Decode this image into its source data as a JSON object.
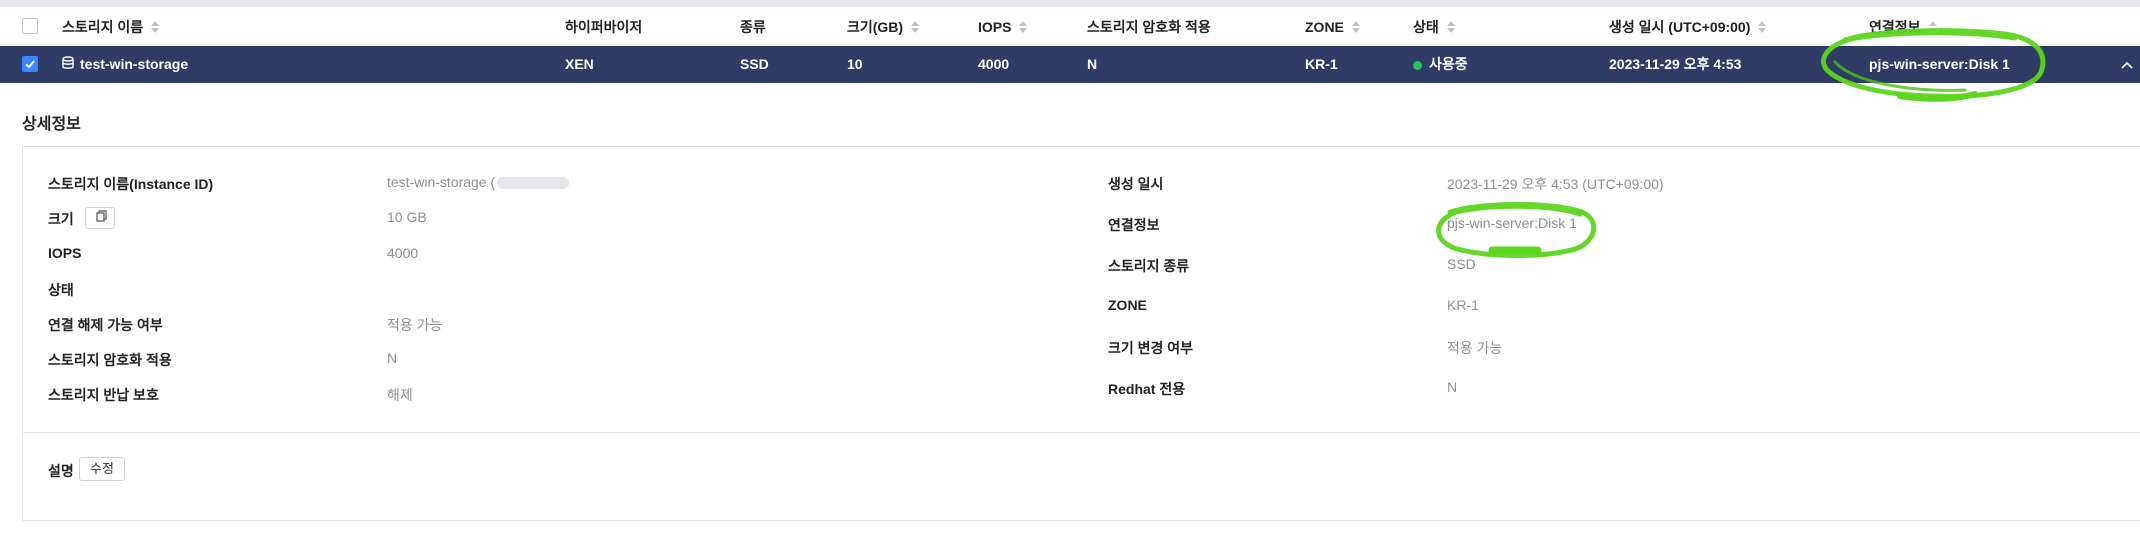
{
  "table": {
    "headers": {
      "name": "스토리지 이름",
      "hypervisor": "하이퍼바이저",
      "type": "종류",
      "size": "크기(GB)",
      "iops": "IOPS",
      "encryption": "스토리지 암호화 적용",
      "zone": "ZONE",
      "status": "상태",
      "created": "생성 일시 (UTC+09:00)",
      "connection": "연결정보"
    },
    "row": {
      "name": "test-win-storage",
      "hypervisor": "XEN",
      "type": "SSD",
      "size": "10",
      "iops": "4000",
      "encryption": "N",
      "zone": "KR-1",
      "status": "사용중",
      "created": "2023-11-29 오후 4:53",
      "connection": "pjs-win-server:Disk 1"
    }
  },
  "details": {
    "title": "상세정보",
    "left": {
      "name_label": "스토리지 이름(Instance ID)",
      "name_value": "test-win-storage (",
      "size_label": "크기",
      "size_value": "10 GB",
      "iops_label": "IOPS",
      "iops_value": "4000",
      "status_label": "상태",
      "detach_label": "연결 해제 가능 여부",
      "detach_value": "적용 가능",
      "encryption_label": "스토리지 암호화 적용",
      "encryption_value": "N",
      "protect_label": "스토리지 반납 보호",
      "protect_value": "해제"
    },
    "right": {
      "created_label": "생성 일시",
      "created_value": "2023-11-29 오후 4:53 (UTC+09:00)",
      "connection_label": "연결정보",
      "connection_value": "pjs-win-server:Disk 1",
      "type_label": "스토리지 종류",
      "type_value": "SSD",
      "zone_label": "ZONE",
      "zone_value": "KR-1",
      "resize_label": "크기 변경 여부",
      "resize_value": "적용 가능",
      "redhat_label": "Redhat 전용",
      "redhat_value": "N"
    },
    "description_label": "설명",
    "edit_button": "수정"
  },
  "colors": {
    "selected_row": "#2e3c66",
    "status_dot": "#22c55e",
    "checkbox": "#3a86ff",
    "highlight_scribble": "#5cd61e"
  },
  "icons": [
    "checkbox",
    "database-icon",
    "sort-icon",
    "copy-icon",
    "chevron-up-icon"
  ]
}
